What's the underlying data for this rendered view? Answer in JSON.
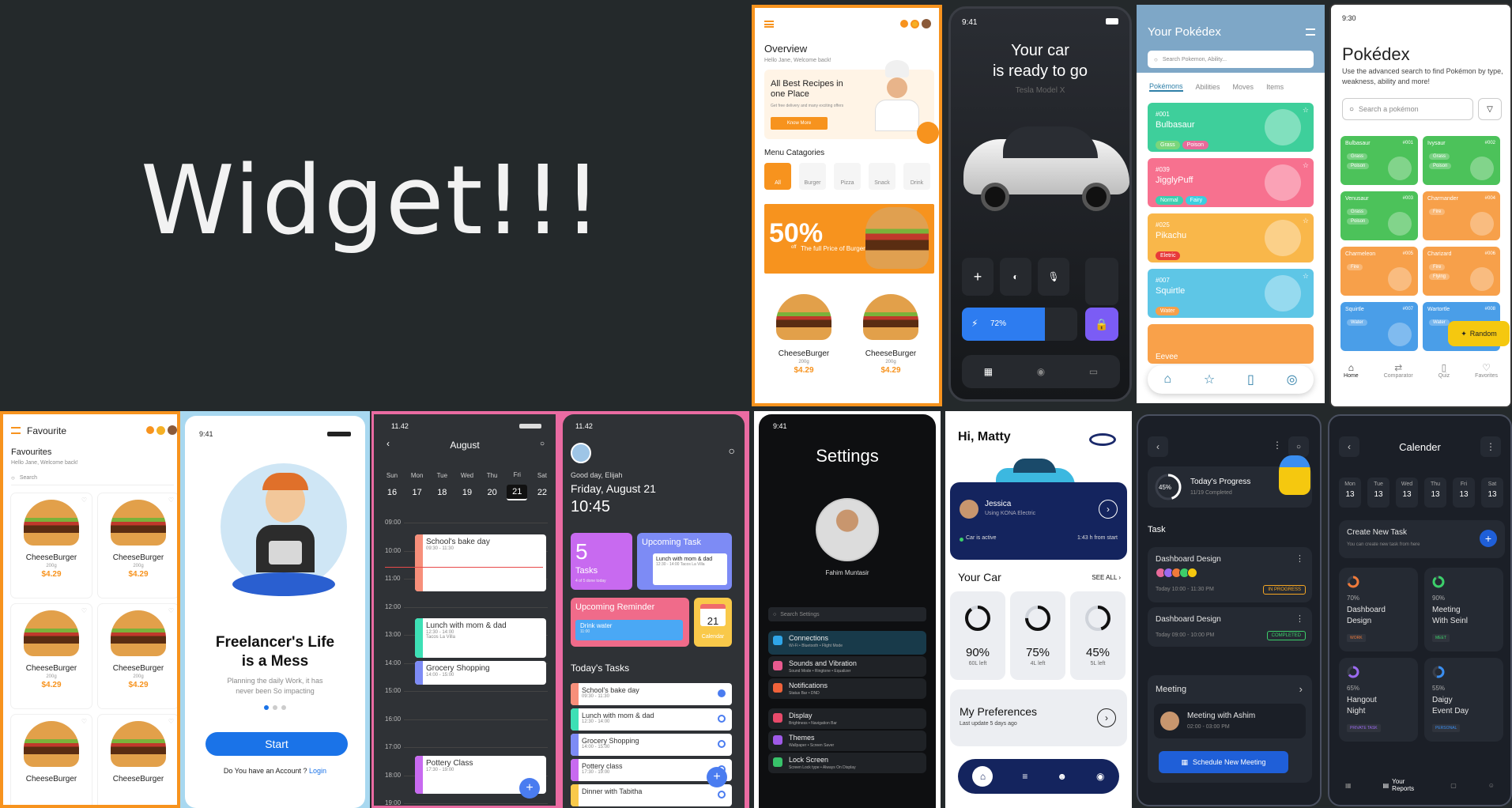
{
  "hero": {
    "title": "Widget!!!"
  },
  "food_overview": {
    "title": "Overview",
    "greeting": "Hello Jane, Welcome back!",
    "banner_title": "All Best Recipes in one Place",
    "banner_sub": "Get free delivery and many exciting offers",
    "banner_btn": "Know More",
    "menu_title": "Menu Catagories",
    "categories": [
      "All",
      "Burger",
      "Pizza",
      "Snack",
      "Drink"
    ],
    "promo_big": "50%",
    "promo_off": "off",
    "promo_text": "The full Price of Burger",
    "items": [
      {
        "name": "CheeseBurger",
        "weight": "200g",
        "price": "$4.29"
      },
      {
        "name": "CheeseBurger",
        "weight": "200g",
        "price": "$4.29"
      }
    ]
  },
  "car": {
    "time": "9:41",
    "headline1": "Your car",
    "headline2": "is ready to go",
    "model": "Tesla Model X",
    "battery": "72%"
  },
  "pokedex_list": {
    "title": "Your Pokédex",
    "search_placeholder": "Search Pokemon, Ability...",
    "tabs": [
      "Pokémons",
      "Abilities",
      "Moves",
      "Items"
    ],
    "cards": [
      {
        "num": "#001",
        "name": "Bulbasaur",
        "types": [
          "Grass",
          "Poison"
        ],
        "color": "#3ecf9b"
      },
      {
        "num": "#039",
        "name": "JigglyPuff",
        "types": [
          "Normal",
          "Fairy"
        ],
        "color": "#f7718f"
      },
      {
        "num": "#025",
        "name": "Pikachu",
        "types": [
          "Eletric"
        ],
        "color": "#f9b74a"
      },
      {
        "num": "#007",
        "name": "Squirtle",
        "types": [
          "Water"
        ],
        "color": "#5ec6e6"
      }
    ],
    "partial_card": "Eevee"
  },
  "pokedex_grid": {
    "time": "9:30",
    "title": "Pokédex",
    "subtitle": "Use the advanced search to find Pokémon by type, weakness, ability and more!",
    "search_placeholder": "Search a pokémon",
    "grid": [
      {
        "name": "Bulbasaur",
        "num": "#001",
        "types": [
          "Grass",
          "Poison"
        ],
        "color": "#4cc25a"
      },
      {
        "name": "Ivysaur",
        "num": "#002",
        "types": [
          "Grass",
          "Poison"
        ],
        "color": "#4cc25a"
      },
      {
        "name": "Venusaur",
        "num": "#003",
        "types": [
          "Grass",
          "Poison"
        ],
        "color": "#4cc25a"
      },
      {
        "name": "Charmander",
        "num": "#004",
        "types": [
          "Fire"
        ],
        "color": "#f7a04a"
      },
      {
        "name": "Charmeleon",
        "num": "#005",
        "types": [
          "Fire"
        ],
        "color": "#f7a04a"
      },
      {
        "name": "Charizard",
        "num": "#006",
        "types": [
          "Fire",
          "Flying"
        ],
        "color": "#f7a04a"
      },
      {
        "name": "Squirtle",
        "num": "#007",
        "types": [
          "Water"
        ],
        "color": "#4a9ee8"
      },
      {
        "name": "Wartortle",
        "num": "#008",
        "types": [
          "Water"
        ],
        "color": "#4a9ee8"
      }
    ],
    "random_btn": "Random",
    "nav": [
      "Home",
      "Comparator",
      "Quiz",
      "Favorites"
    ]
  },
  "favourite": {
    "title": "Favourite",
    "heading": "Favourites",
    "greeting": "Hello Jane, Welcome back!",
    "search_placeholder": "Search",
    "items": [
      {
        "name": "CheeseBurger",
        "weight": "200g",
        "price": "$4.29"
      },
      {
        "name": "CheeseBurger",
        "weight": "200g",
        "price": "$4.29"
      },
      {
        "name": "CheeseBurger",
        "weight": "200g",
        "price": "$4.29"
      },
      {
        "name": "CheeseBurger",
        "weight": "200g",
        "price": "$4.29"
      },
      {
        "name": "CheeseBurger",
        "weight": ""
      },
      {
        "name": "CheeseBurger",
        "weight": ""
      }
    ]
  },
  "freelancer": {
    "time": "9:41",
    "title1": "Freelancer's Life",
    "title2": "is a Mess",
    "sub1": "Planning the daily Work, it has",
    "sub2": "never been So impacting",
    "start": "Start",
    "account": "Do You have an Account ?",
    "login": "Login"
  },
  "calendar": {
    "time": "11.42",
    "month": "August",
    "days": [
      {
        "d": "Sun",
        "n": "16"
      },
      {
        "d": "Mon",
        "n": "17"
      },
      {
        "d": "Tue",
        "n": "18"
      },
      {
        "d": "Wed",
        "n": "19"
      },
      {
        "d": "Thu",
        "n": "20"
      },
      {
        "d": "Fri",
        "n": "21"
      },
      {
        "d": "Sat",
        "n": "22"
      }
    ],
    "hours": [
      "09:00",
      "10:00",
      "11:00",
      "12:00",
      "13:00",
      "14:00",
      "15:00",
      "16:00",
      "17:00",
      "18:00",
      "19:00"
    ],
    "events": [
      {
        "t": "School's bake day",
        "s": "09:30 - 11:30",
        "c": "#f78f7a"
      },
      {
        "t": "Lunch with mom & dad",
        "s": "12:30 - 14:00",
        "loc": "Tacos La Villa",
        "c": "#3de0b5"
      },
      {
        "t": "Grocery Shopping",
        "s": "14:00 - 15:00",
        "c": "#7d8bf5"
      },
      {
        "t": "Pottery Class",
        "s": "17:30 - 19:00",
        "c": "#c86af0"
      }
    ]
  },
  "dashboard": {
    "time": "11.42",
    "greeting": "Good day, Elijah",
    "date": "Friday, August 21",
    "clock": "10:45",
    "tasks_count": "5",
    "tasks_label": "Tasks",
    "tasks_sub": "4 of 5 done today",
    "upcoming_task": "Upcoming Task",
    "upcoming_item": "Lunch with mom & dad",
    "upcoming_time": "12:30 - 14:00",
    "upcoming_loc": "Tacos La Villa",
    "reminder_title": "Upcoming Reminder",
    "reminder_item": "Drink water",
    "reminder_time": "11:00",
    "cal_day": "21",
    "cal_label": "Calendar",
    "today_title": "Today's Tasks",
    "today": [
      {
        "t": "School's bake day",
        "s": "09:30 - 11:30",
        "c": "#f78f7a"
      },
      {
        "t": "Lunch with mom & dad",
        "s": "12:30 - 14:00",
        "c": "#3de0b5"
      },
      {
        "t": "Grocery Shopping",
        "s": "14:00 - 15:00",
        "c": "#7d8bf5"
      },
      {
        "t": "Pottery class",
        "s": "17:30 - 19:00",
        "c": "#c86af0"
      },
      {
        "t": "Dinner with Tabitha",
        "s": "",
        "c": "#f9c94a"
      }
    ]
  },
  "settings": {
    "time": "9:41",
    "title": "Settings",
    "user": "Fahim Muntasir",
    "search_placeholder": "Search Settings",
    "rows": [
      {
        "t": "Connections",
        "s": "Wi-Fi  •  Bluetooth  •  Flight Mode",
        "c": "#2fa6e8"
      },
      {
        "t": "Sounds and Vibration",
        "s": "Sound Mode  •  Ringtone  •  Equalizer",
        "c": "#e85a8f"
      },
      {
        "t": "Notifications",
        "s": "Status Bar  •  DND",
        "c": "#f0623a"
      },
      {
        "t": "Display",
        "s": "Brightness  •  Navigation Bar",
        "c": "#e84a6a"
      },
      {
        "t": "Themes",
        "s": "Wallpaper  •  Screen Saver",
        "c": "#a05ae8"
      },
      {
        "t": "Lock Screen",
        "s": "Screen Lock type  •  Always On Display",
        "c": "#38c26a"
      }
    ]
  },
  "hyundai": {
    "greeting": "Hi, Matty",
    "driver": "Jessica",
    "driver_sub": "Using KONA Electric",
    "status": "Car is active",
    "since": "1:43 h from start",
    "your_car": "Your Car",
    "see_all": "SEE ALL",
    "gauges": [
      {
        "p": "90%",
        "l": "60L left",
        "v": 0.9
      },
      {
        "p": "75%",
        "l": "4L left",
        "v": 0.75
      },
      {
        "p": "45%",
        "l": "5L left",
        "v": 0.45
      }
    ],
    "pref_title": "My Preferences",
    "pref_sub": "Last update 5 days ago"
  },
  "tasks_dark": {
    "progress_pct": "45%",
    "progress_title": "Today's Progress",
    "progress_sub": "11/19 Completed",
    "progress_value": 0.45,
    "task_label": "Task",
    "tasks": [
      {
        "t": "Dashboard Design",
        "time": "Today 10:00 - 11:30 PM",
        "status": "IN PROGRESS",
        "sc": "#f5a623"
      },
      {
        "t": "Dashboard Design",
        "time": "Today 09:00 - 10:00 PM",
        "status": "COMPLETED",
        "sc": "#3ccf6a"
      }
    ],
    "meeting_label": "Meeting",
    "meeting_item": "Meeting with Ashim",
    "meeting_time": "02:00 - 03:00 PM",
    "schedule_btn": "Schedule New Meeting"
  },
  "calender_dark": {
    "title": "Calender",
    "days": [
      {
        "d": "Mon",
        "n": "13"
      },
      {
        "d": "Tue",
        "n": "13"
      },
      {
        "d": "Wed",
        "n": "13"
      },
      {
        "d": "Thu",
        "n": "13"
      },
      {
        "d": "Fri",
        "n": "13"
      },
      {
        "d": "Sat",
        "n": "13"
      }
    ],
    "create_title": "Create New Task",
    "create_sub": "You can create new task from here",
    "cards": [
      {
        "p": "70%",
        "t1": "Dashboard",
        "t2": "Design",
        "tag": "WORK",
        "c": "#f07a3a",
        "v": 0.7
      },
      {
        "p": "90%",
        "t1": "Meeting",
        "t2": "With Seinl",
        "tag": "MEET",
        "c": "#3ccf6a",
        "v": 0.9
      },
      {
        "p": "65%",
        "t1": "Hangout",
        "t2": "Night",
        "tag": "PRIVATE TASK",
        "c": "#9b6af0",
        "v": 0.65
      },
      {
        "p": "55%",
        "t1": "Daigy",
        "t2": "Event Day",
        "tag": "PERSONAL",
        "c": "#3a8ef0",
        "v": 0.55
      }
    ],
    "reports": "Your Reports"
  }
}
